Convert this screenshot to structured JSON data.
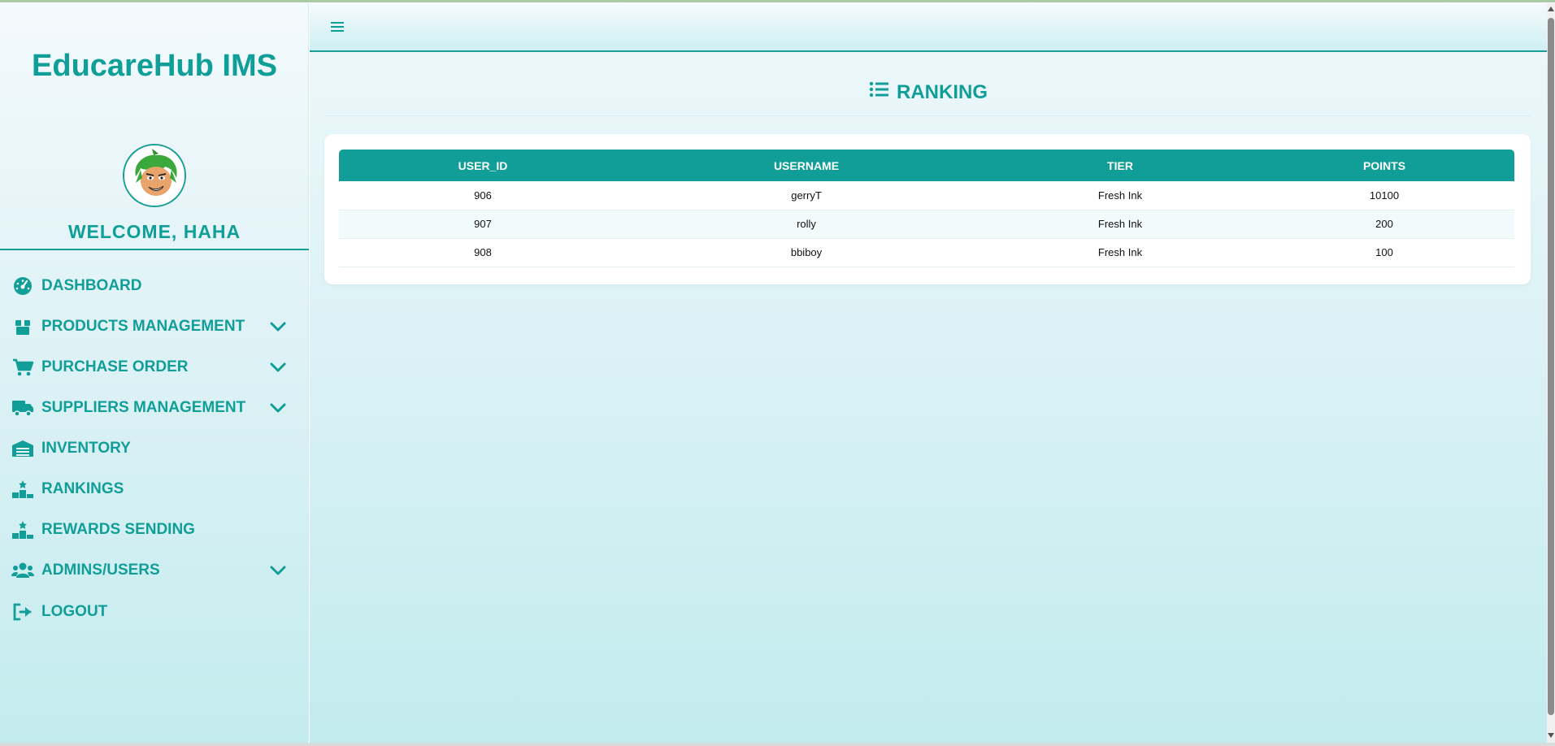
{
  "brand": {
    "title": "EducareHub IMS"
  },
  "user": {
    "welcome": "WELCOME, HAHA"
  },
  "sidebar": {
    "items": [
      {
        "label": "DASHBOARD",
        "icon": "gauge-icon",
        "has_submenu": false
      },
      {
        "label": "PRODUCTS MANAGEMENT",
        "icon": "box-icon",
        "has_submenu": true
      },
      {
        "label": "PURCHASE ORDER",
        "icon": "cart-icon",
        "has_submenu": true
      },
      {
        "label": "SUPPLIERS MANAGEMENT",
        "icon": "truck-icon",
        "has_submenu": true
      },
      {
        "label": "INVENTORY",
        "icon": "warehouse-icon",
        "has_submenu": false
      },
      {
        "label": "RANKINGS",
        "icon": "ranking-podium-icon",
        "has_submenu": false
      },
      {
        "label": "REWARDS SENDING",
        "icon": "ranking-podium-icon",
        "has_submenu": false
      },
      {
        "label": "ADMINS/USERS",
        "icon": "users-icon",
        "has_submenu": true
      },
      {
        "label": "LOGOUT",
        "icon": "logout-icon",
        "has_submenu": false
      }
    ]
  },
  "main": {
    "title": "RANKING",
    "title_icon": "list-icon",
    "table": {
      "columns": [
        "USER_ID",
        "USERNAME",
        "TIER",
        "POINTS"
      ],
      "rows": [
        [
          "906",
          "gerryT",
          "Fresh Ink",
          "10100"
        ],
        [
          "907",
          "rolly",
          "Fresh Ink",
          "200"
        ],
        [
          "908",
          "bbiboy",
          "Fresh Ink",
          "100"
        ]
      ]
    }
  },
  "colors": {
    "accent": "#129e98",
    "sidebar_top": "#f3fafd",
    "sidebar_bottom": "#c3ecee",
    "table_header": "#129e98"
  }
}
